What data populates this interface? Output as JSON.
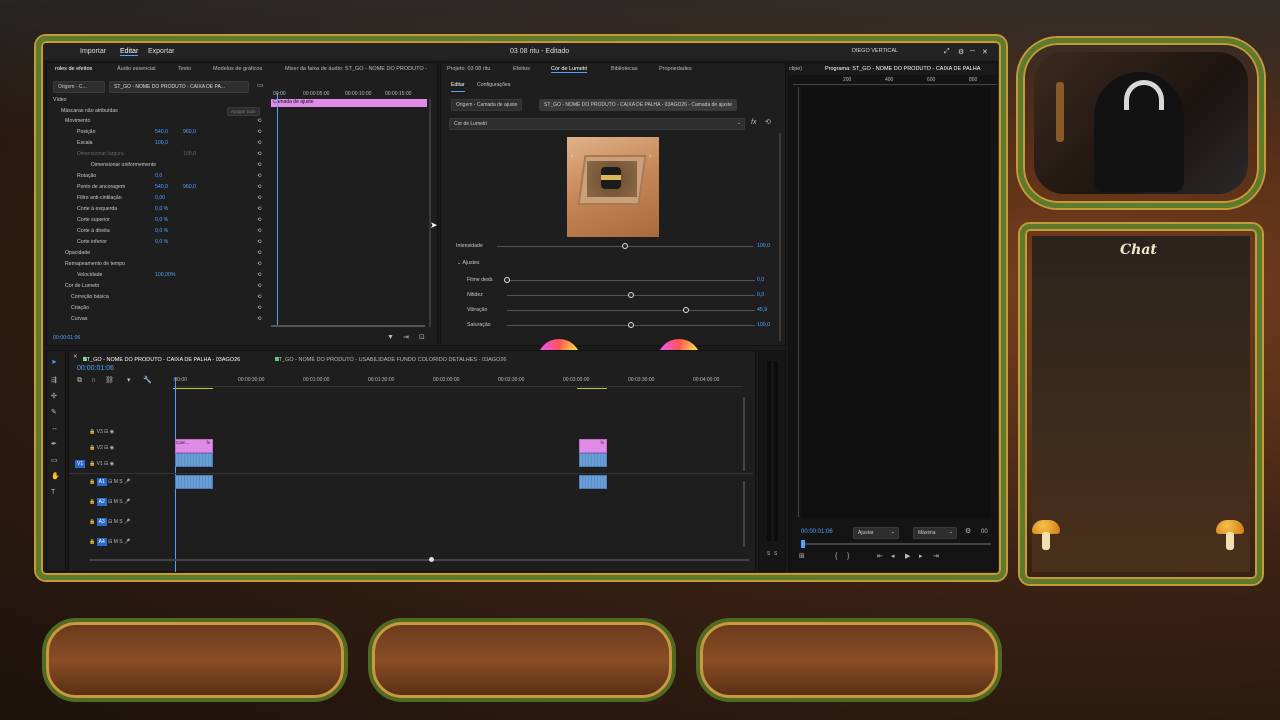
{
  "window": {
    "title": "03 08 ritu - Editado",
    "user": "DIEGO VERTICAL"
  },
  "menu": {
    "import": "Importar",
    "edit": "Editar",
    "export": "Exportar"
  },
  "left_tabs": [
    "roles de efeitos",
    "Áudio essencial",
    "Texto",
    "Modelos de gráficos",
    "Mixer da faixa de áudio: ST_GO - NOME DO PRODUTO -"
  ],
  "effect_controls": {
    "source_tab": "Origem - C...",
    "clip_tab": "ST_GO - NOME DO PRODUTO - CAIXA DE PA...",
    "layer_label": "Camada de ajuste",
    "ruler": [
      "00:00",
      "00:00:05:00",
      "00:00:10:00",
      "00:00:15:00"
    ],
    "video_label": "Vídeo",
    "mask_label": "Máscaras não atribuídas",
    "clear_label": "Apagar tudo",
    "rows": [
      {
        "label": "Movimento",
        "v1": "",
        "v2": ""
      },
      {
        "label": "Posição",
        "v1": "540,0",
        "v2": "960,0"
      },
      {
        "label": "Escala",
        "v1": "100,0",
        "v2": ""
      },
      {
        "label": "Dimensionar largura",
        "v1": "",
        "v2": "100,0"
      },
      {
        "label": "Dimensionar uniformemente",
        "v1": "",
        "v2": ""
      },
      {
        "label": "Rotação",
        "v1": "0,0",
        "v2": ""
      },
      {
        "label": "Ponto de ancoragem",
        "v1": "540,0",
        "v2": "960,0"
      },
      {
        "label": "Filtro anti-cintilação",
        "v1": "0,00",
        "v2": ""
      },
      {
        "label": "Corte à esquerda",
        "v1": "0,0 %",
        "v2": ""
      },
      {
        "label": "Corte superior",
        "v1": "0,0 %",
        "v2": ""
      },
      {
        "label": "Corte à direita",
        "v1": "0,0 %",
        "v2": ""
      },
      {
        "label": "Corte inferior",
        "v1": "0,0 %",
        "v2": ""
      },
      {
        "label": "Opacidade",
        "v1": "",
        "v2": ""
      },
      {
        "label": "Remapeamento de tempo",
        "v1": "",
        "v2": ""
      },
      {
        "label": "Velocidade",
        "v1": "100,00%",
        "v2": ""
      },
      {
        "label": "Cor de Lumetri",
        "v1": "",
        "v2": ""
      },
      {
        "label": "Correção básica",
        "v1": "",
        "v2": ""
      },
      {
        "label": "Criação",
        "v1": "",
        "v2": ""
      },
      {
        "label": "Curvas",
        "v1": "",
        "v2": ""
      }
    ],
    "timecode": "00:00:01:06"
  },
  "project_tabs": [
    "Projeto: 03 08 ritu",
    "Efeitos",
    "Cor de Lumetri",
    "Bibliotecas",
    "Propriedades"
  ],
  "lumetri": {
    "sub_edit": "Editar",
    "sub_config": "Configurações",
    "source_btn": "Origem - Camada de ajuste",
    "clip_btn": "ST_GO - NOME DO PRODUTO - CAIXA DE PALHA - 03AGO26 - Camada de ajuste",
    "effect_select": "Cor de Lumetri",
    "intensity_label": "Intensidade",
    "intensity_value": "100,0",
    "intensity": 1.0,
    "adjust_label": "Ajustes",
    "sliders": [
      {
        "label": "Filme desb.",
        "value": "0,0",
        "pos": 0.0
      },
      {
        "label": "Nitidez",
        "value": "0,0",
        "pos": 0.5
      },
      {
        "label": "Vibração",
        "value": "45,9",
        "pos": 0.72
      },
      {
        "label": "Saturação",
        "value": "100,0",
        "pos": 0.5
      }
    ]
  },
  "program": {
    "tab_left": "clipe)",
    "tab": "Programa: ST_GO - NOME DO PRODUTO - CAIXA DE PALHA",
    "ruler": [
      "200",
      "400",
      "600",
      "800"
    ],
    "timecode": "00:00:01:06",
    "fit": "Ajustar",
    "quality": "Máxima",
    "right_code": "00"
  },
  "timeline": {
    "tab1": "ST_GO - NOME DO PRODUTO - CAIXA DE PALHA - 03AGO26",
    "tab2": "ST_GO - NOME DO PRODUTO - USABILIDADE FUNDO COLORIDO DETALHES - 03AGO26",
    "timecode": "00:00:01:06",
    "ruler": [
      ":00:00",
      "00:00:30:00",
      "00:01:00:00",
      "00:01:30:00",
      "00:02:00:00",
      "00:02:30:00",
      "00:03:00:00",
      "00:03:30:00",
      "00:04:00:00"
    ],
    "video_tracks": [
      "V3",
      "V2",
      "V1"
    ],
    "audio_tracks": [
      "A1",
      "A2",
      "A3",
      "A4"
    ],
    "clip1_label": "Cam...",
    "clip_fx": "fx",
    "meter_labels": [
      "S",
      "S"
    ]
  },
  "overlay": {
    "chat_title": "Chat"
  },
  "colors": {
    "accent": "#4fa3ff",
    "clip_video": "#e08be8",
    "clip_audio": "#6a9fd8",
    "frame_vine": "#5d7b2a",
    "frame_gold": "#c49a3a"
  }
}
